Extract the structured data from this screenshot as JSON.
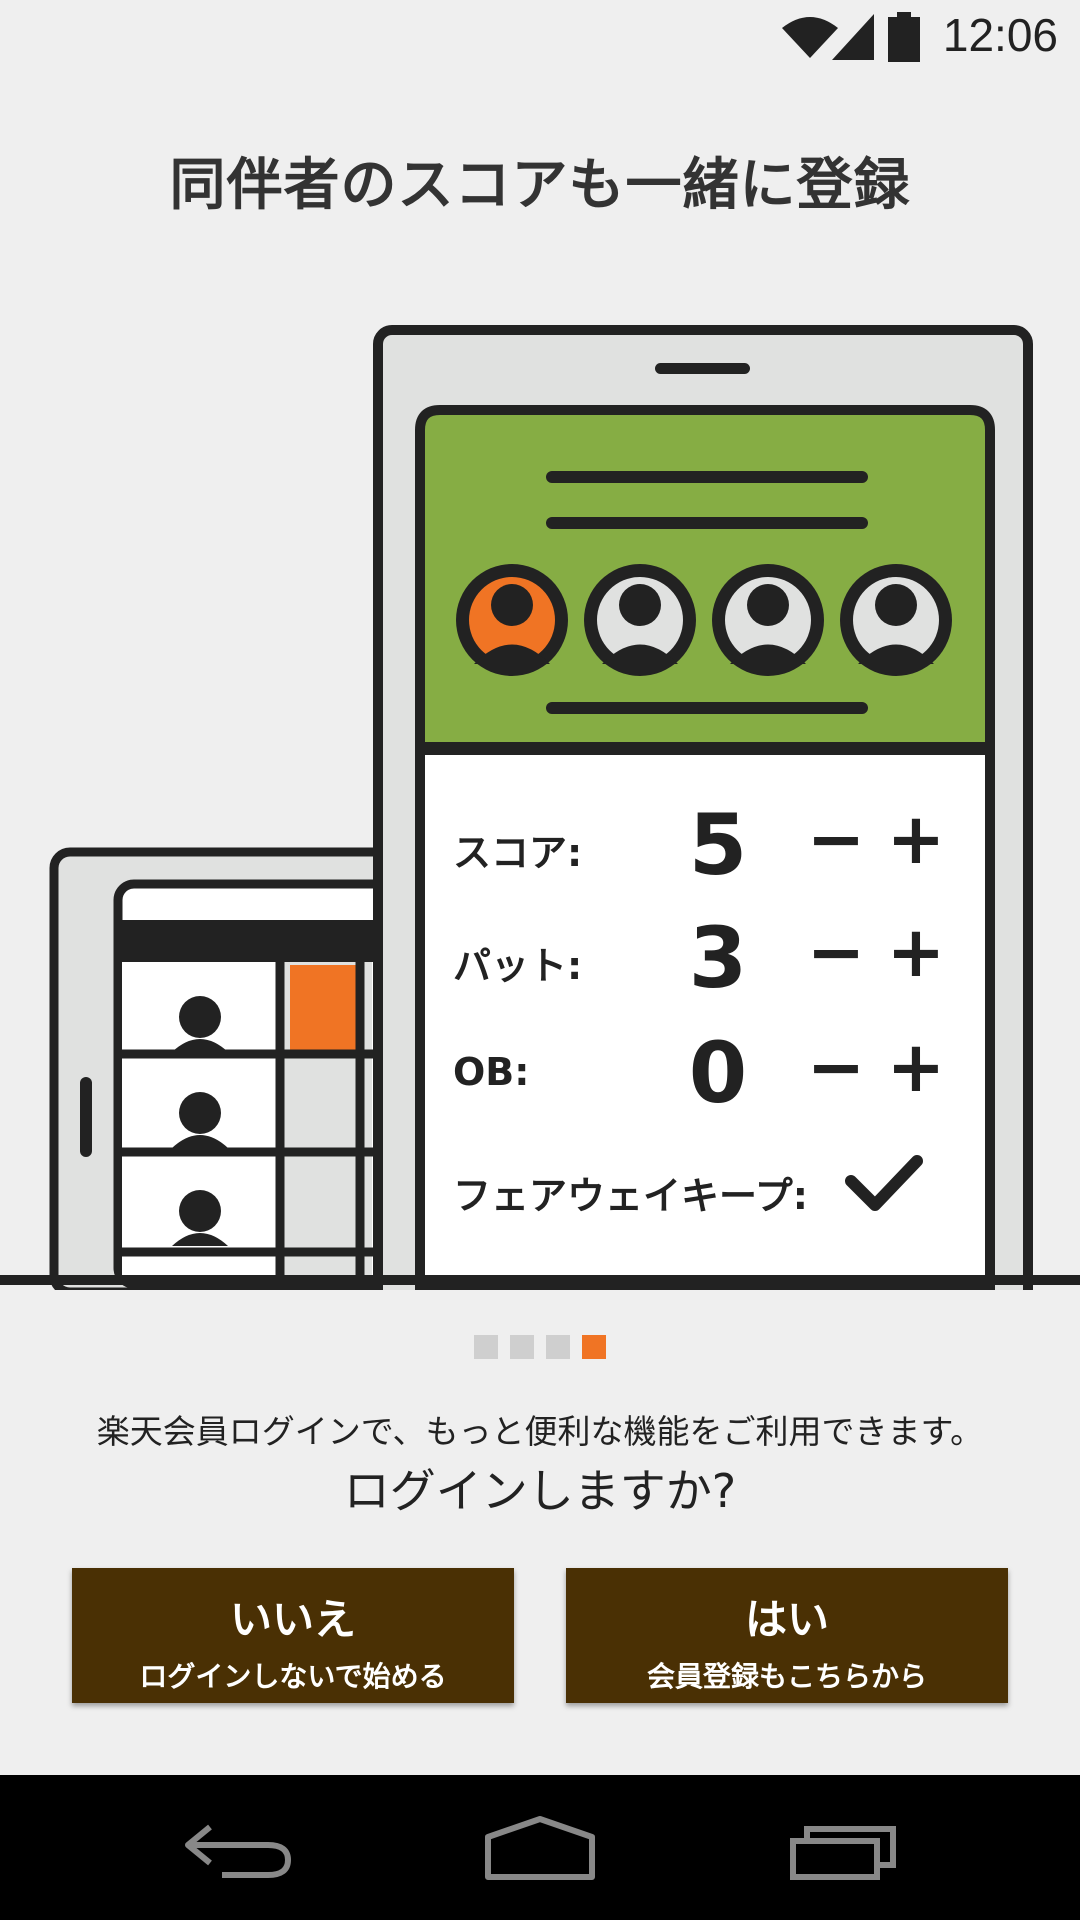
{
  "status_bar": {
    "time": "12:06",
    "icons": [
      "wifi-icon",
      "signal-icon",
      "battery-icon"
    ]
  },
  "headline": "同伴者のスコアも一緒に登録",
  "illustration": {
    "score_rows": [
      {
        "label": "スコア:",
        "value": "5",
        "minus": "−",
        "plus": "+"
      },
      {
        "label": "パット:",
        "value": "3",
        "minus": "−",
        "plus": "+"
      },
      {
        "label": "OB:",
        "value": "0",
        "minus": "−",
        "plus": "+"
      }
    ],
    "fairway_label": "フェアウェイキープ:",
    "colors": {
      "green": "#86ad44",
      "orange": "#f07424",
      "dark": "#222222",
      "grey": "#e0e1e0"
    }
  },
  "pagination": {
    "total": 4,
    "active_index": 3
  },
  "info_text": "楽天会員ログインで、もっと便利な機能をご利用できます。",
  "question": "ログインしますか?",
  "buttons": {
    "no": {
      "title": "いいえ",
      "subtitle": "ログインしないで始める"
    },
    "yes": {
      "title": "はい",
      "subtitle": "会員登録もこちらから"
    }
  },
  "nav_bar": {
    "icons": [
      "back-icon",
      "home-icon",
      "recent-apps-icon"
    ]
  },
  "brand_color": "#4a3004"
}
